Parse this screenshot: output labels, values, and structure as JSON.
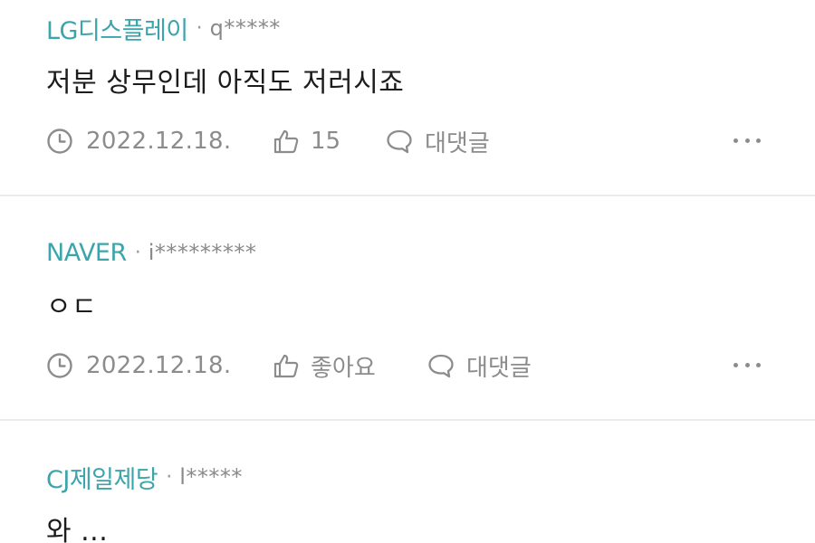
{
  "comments": [
    {
      "company": "LG디스플레이",
      "separator": "·",
      "user": "q*****",
      "text": "저분 상무인데 아직도 저러시죠",
      "date": "2022.12.18.",
      "like_label": "15",
      "reply_label": "대댓글"
    },
    {
      "company": "NAVER",
      "separator": "·",
      "user": "i*********",
      "text": "ㅇㄷ",
      "date": "2022.12.18.",
      "like_label": "좋아요",
      "reply_label": "대댓글"
    },
    {
      "company": "CJ제일제당",
      "separator": "·",
      "user": "l*****",
      "text": "와 ..."
    }
  ],
  "icons": {
    "time": "clock-icon",
    "like": "thumbs-up-icon",
    "reply": "speech-bubble-icon",
    "more": "more-dots-icon"
  },
  "colors": {
    "company": "#3aa5ab",
    "meta": "#8c8c8c",
    "text": "#1c1c1c",
    "divider": "#ececec"
  }
}
